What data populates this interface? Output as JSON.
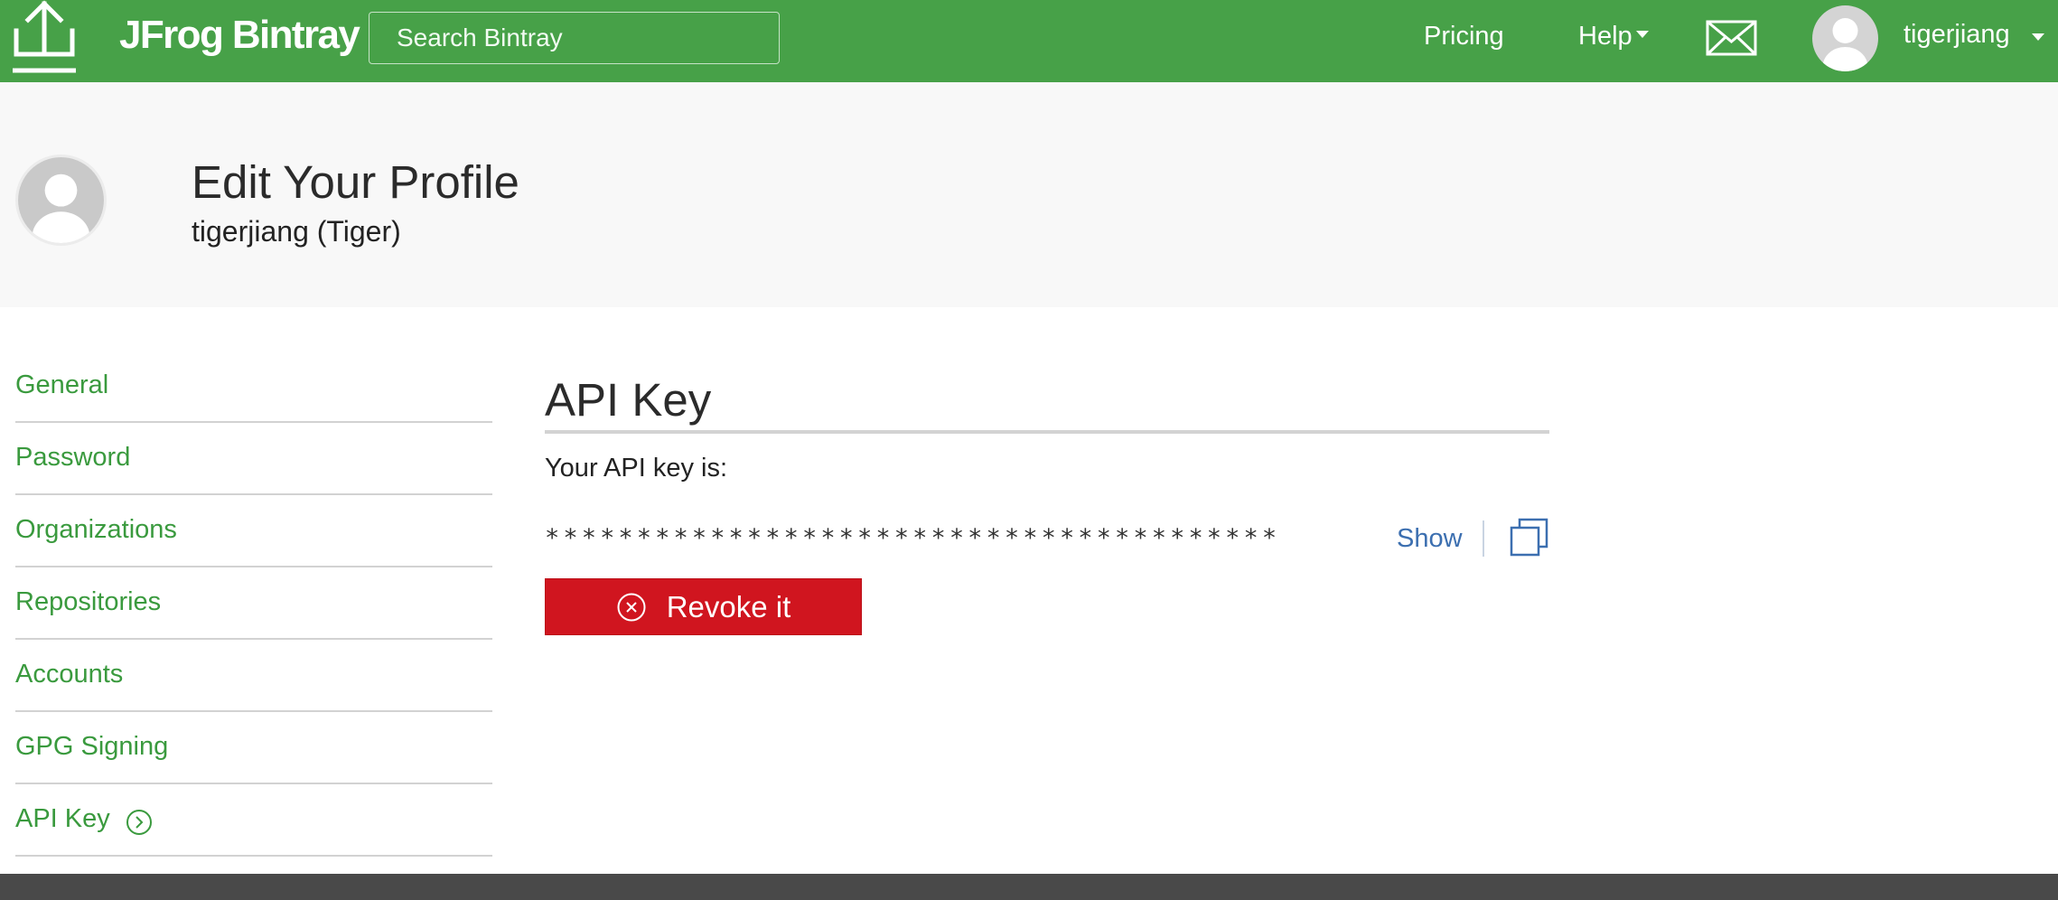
{
  "nav": {
    "brand": "JFrog Bintray",
    "search_placeholder": "Search Bintray",
    "pricing": "Pricing",
    "help": "Help",
    "username": "tigerjiang",
    "logo_icon": "download-arrow-icon",
    "mail_icon": "envelope-icon",
    "avatar_icon": "user-avatar-icon",
    "brand_color": "#47a148"
  },
  "profile": {
    "title": "Edit Your Profile",
    "subtitle": "tigerjiang (Tiger)"
  },
  "sidebar": {
    "items": [
      {
        "label": "General"
      },
      {
        "label": "Password"
      },
      {
        "label": "Organizations"
      },
      {
        "label": "Repositories"
      },
      {
        "label": "Accounts"
      },
      {
        "label": "GPG Signing"
      },
      {
        "label": "API Key",
        "active": true
      }
    ],
    "active_icon": "chevron-right-circle-icon",
    "link_color": "#3a9a3e"
  },
  "api_key": {
    "title": "API Key",
    "label": "Your API key is:",
    "masked_value": "****************************************",
    "show_label": "Show",
    "copy_icon": "copy-icon",
    "revoke_label": "Revoke it",
    "revoke_icon": "close-circle-icon",
    "revoke_color": "#d0151f"
  }
}
